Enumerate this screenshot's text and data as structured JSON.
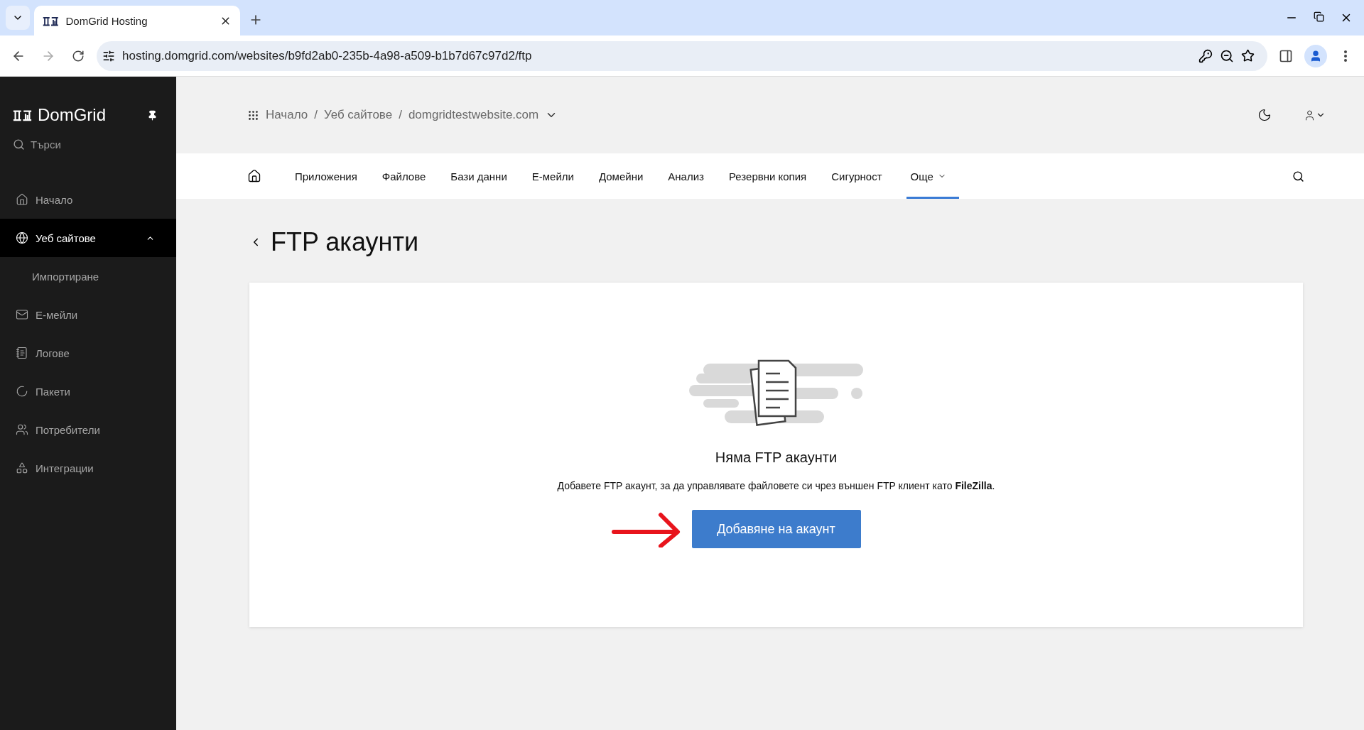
{
  "browser": {
    "tabs": [
      {
        "title": "DomGrid Hosting",
        "selected": true
      }
    ],
    "url": "hosting.domgrid.com/websites/b9fd2ab0-235b-4a98-a509-b1b7d67c97d2/ftp"
  },
  "sidebar": {
    "brand": "DomGrid",
    "search_placeholder": "Търси",
    "items": [
      {
        "label": "Начало",
        "selected": false
      },
      {
        "label": "Уеб сайтове",
        "selected": true,
        "expanded": true,
        "children": [
          {
            "label": "Импортиране",
            "selected": false
          }
        ]
      },
      {
        "label": "Е-мейли",
        "selected": false
      },
      {
        "label": "Логове",
        "selected": false
      },
      {
        "label": "Пакети",
        "selected": false
      },
      {
        "label": "Потребители",
        "selected": false
      },
      {
        "label": "Интеграции",
        "selected": false
      }
    ]
  },
  "breadcrumb": {
    "items": [
      "Начало",
      "Уеб сайтове",
      "domgridtestwebsite.com"
    ],
    "separators": [
      "/",
      "/"
    ]
  },
  "nav_tabs": [
    {
      "label": "Приложения",
      "selected": false
    },
    {
      "label": "Файлове",
      "selected": false
    },
    {
      "label": "Бази данни",
      "selected": false
    },
    {
      "label": "Е-мейли",
      "selected": false
    },
    {
      "label": "Домейни",
      "selected": false
    },
    {
      "label": "Анализ",
      "selected": false
    },
    {
      "label": "Резервни копия",
      "selected": false
    },
    {
      "label": "Сигурност",
      "selected": false
    },
    {
      "label": "Още",
      "selected": true,
      "dropdown": true
    }
  ],
  "page_title": "FTP акаунти",
  "empty_state": {
    "title": "Няма FTP акаунти",
    "description": "Добавете FTP акаунт, за да управлявате файловете си чрез външен FTP клиент като **FileZilla**.",
    "button": "Добавяне на акаунт"
  }
}
